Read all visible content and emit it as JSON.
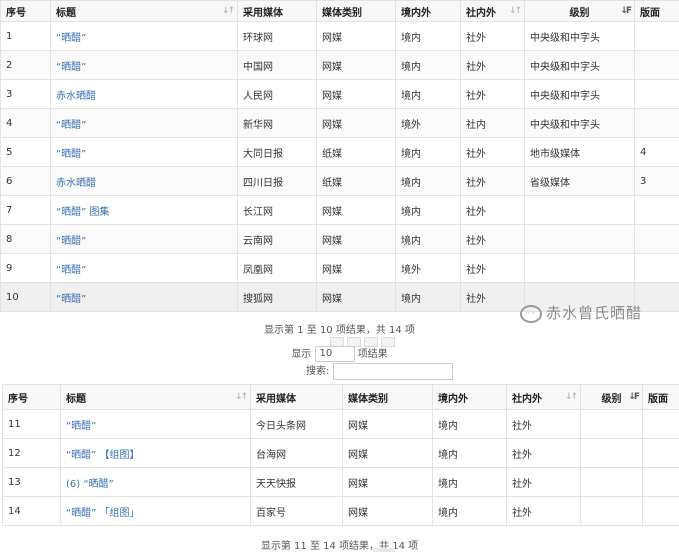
{
  "headers": [
    "序号",
    "标题",
    "采用媒体",
    "媒体类别",
    "境内外",
    "社内外",
    "级别",
    "版面"
  ],
  "sort_icons": {
    "neutral": "↓↑",
    "active": "↓F"
  },
  "table1": {
    "rows": [
      {
        "no": "1",
        "title": "“晒醋”",
        "media": "环球网",
        "type": "网媒",
        "domestic": "境内",
        "insider": "社外",
        "level": "中央级和中字头",
        "page": ""
      },
      {
        "no": "2",
        "title": "“晒醋”",
        "media": "中国网",
        "type": "网媒",
        "domestic": "境内",
        "insider": "社外",
        "level": "中央级和中字头",
        "page": ""
      },
      {
        "no": "3",
        "title": "赤水晒醋",
        "media": "人民网",
        "type": "网媒",
        "domestic": "境内",
        "insider": "社外",
        "level": "中央级和中字头",
        "page": ""
      },
      {
        "no": "4",
        "title": "“晒醋”",
        "media": "新华网",
        "type": "网媒",
        "domestic": "境外",
        "insider": "社内",
        "level": "中央级和中字头",
        "page": ""
      },
      {
        "no": "5",
        "title": "“晒醋”",
        "media": "大同日报",
        "type": "纸媒",
        "domestic": "境内",
        "insider": "社外",
        "level": "地市级媒体",
        "page": "4"
      },
      {
        "no": "6",
        "title": "赤水晒醋",
        "media": "四川日报",
        "type": "纸媒",
        "domestic": "境内",
        "insider": "社外",
        "level": "省级媒体",
        "page": "3"
      },
      {
        "no": "7",
        "title": "“晒醋” 图集",
        "media": "长江网",
        "type": "网媒",
        "domestic": "境内",
        "insider": "社外",
        "level": "",
        "page": ""
      },
      {
        "no": "8",
        "title": "“晒醋”",
        "media": "云南网",
        "type": "网媒",
        "domestic": "境内",
        "insider": "社外",
        "level": "",
        "page": ""
      },
      {
        "no": "9",
        "title": "“晒醋”",
        "media": "凤凰网",
        "type": "网媒",
        "domestic": "境外",
        "insider": "社外",
        "level": "",
        "page": ""
      },
      {
        "no": "10",
        "title": "“晒醋”",
        "media": "搜狐网",
        "type": "网媒",
        "domestic": "境内",
        "insider": "社外",
        "level": "",
        "page": ""
      }
    ]
  },
  "info1": "显示第 1 至 10 项结果，共 14 项",
  "length": {
    "prefix": "显示",
    "value": "10",
    "suffix": "项结果"
  },
  "search": {
    "label": "搜索:"
  },
  "watermark": "赤水曾氏晒醋",
  "table2": {
    "rows": [
      {
        "no": "11",
        "title": "“晒醋”",
        "media": "今日头条网",
        "type": "网媒",
        "domestic": "境内",
        "insider": "社外",
        "level": "",
        "page": ""
      },
      {
        "no": "12",
        "title": "“晒醋” 【组图】",
        "media": "台海网",
        "type": "网媒",
        "domestic": "境内",
        "insider": "社外",
        "level": "",
        "page": ""
      },
      {
        "no": "13",
        "title": "(6) “晒醋”",
        "media": "天天快报",
        "type": "网媒",
        "domestic": "境内",
        "insider": "社外",
        "level": "",
        "page": ""
      },
      {
        "no": "14",
        "title": "“晒醋” 「组图」",
        "media": "百家号",
        "type": "网媒",
        "domestic": "境内",
        "insider": "社外",
        "level": "",
        "page": ""
      }
    ]
  },
  "info2": "显示第 11 至 14 项结果，共 14 项"
}
